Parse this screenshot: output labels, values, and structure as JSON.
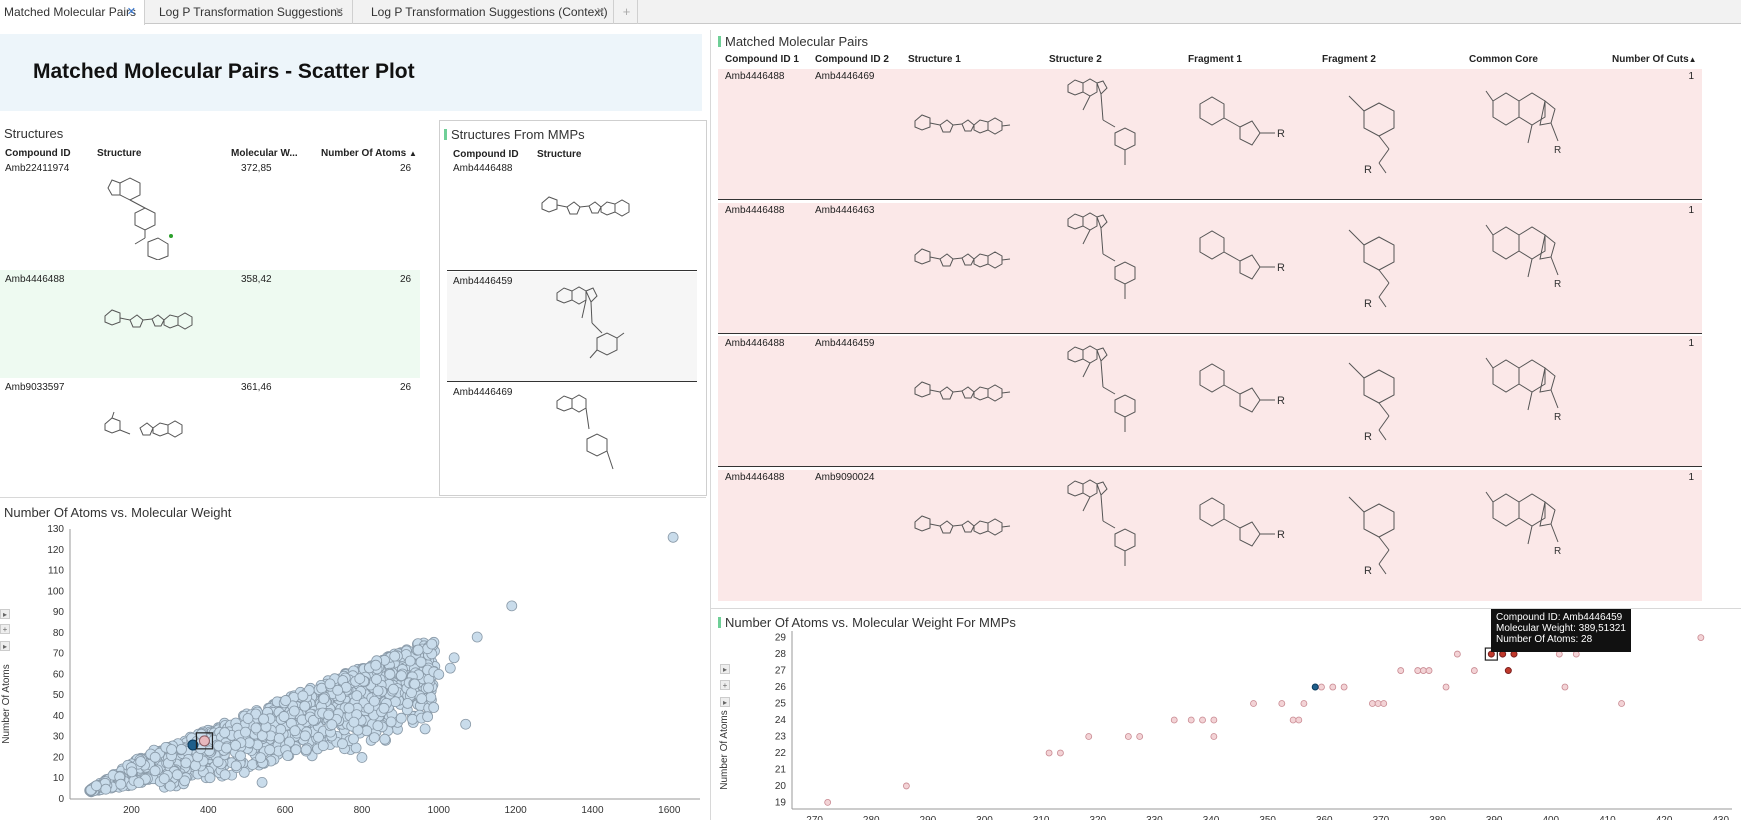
{
  "tabs": [
    {
      "label": "Matched Molecular Pairs"
    },
    {
      "label": "Log P Transformation Suggestions"
    },
    {
      "label": "Log P Transformation Suggestions (Context)"
    }
  ],
  "add_tab": "+",
  "banner": {
    "title": "Matched Molecular Pairs - Scatter Plot"
  },
  "structures": {
    "title": "Structures",
    "columns": [
      "Compound ID",
      "Structure",
      "Molecular W...",
      "Number Of Atoms"
    ],
    "sort_arrow": "▲",
    "rows": [
      {
        "id": "Amb22411974",
        "mw": "372,85",
        "atoms": "26"
      },
      {
        "id": "Amb4446488",
        "mw": "358,42",
        "atoms": "26"
      },
      {
        "id": "Amb9033597",
        "mw": "361,46",
        "atoms": "26"
      }
    ]
  },
  "structures_mmp": {
    "title": "Structures From MMPs",
    "columns": [
      "Compound ID",
      "Structure"
    ],
    "rows": [
      {
        "id": "Amb4446488"
      },
      {
        "id": "Amb4446459"
      },
      {
        "id": "Amb4446469"
      }
    ]
  },
  "mmp_table": {
    "title": "Matched Molecular Pairs",
    "columns": [
      "Compound ID 1",
      "Compound ID 2",
      "Structure 1",
      "Structure 2",
      "Fragment 1",
      "Fragment 2",
      "Common Core",
      "Number Of Cuts"
    ],
    "sort_arrow": "▲",
    "rows": [
      {
        "id1": "Amb4446488",
        "id2": "Amb4446469",
        "cuts": "1"
      },
      {
        "id1": "Amb4446488",
        "id2": "Amb4446463",
        "cuts": "1"
      },
      {
        "id1": "Amb4446488",
        "id2": "Amb4446459",
        "cuts": "1"
      },
      {
        "id1": "Amb4446488",
        "id2": "Amb9090024",
        "cuts": "1"
      }
    ],
    "row_bg": "#fbe8e8"
  },
  "plot1": {
    "title": "Number Of Atoms vs. Molecular Weight",
    "ylabel": "Number Of Atoms",
    "point_color": "#c9dceb",
    "highlight_color": "#1f5f8b"
  },
  "plot2": {
    "title": "Number Of Atoms vs. Molecular Weight For MMPs",
    "ylabel": "Number Of Atoms",
    "point_color": "#f3d3d6",
    "marked_color": "#c0392b",
    "tooltip": [
      "Compound ID: Amb4446459",
      "Molecular Weight: 389,51321",
      "Number Of Atoms: 28"
    ]
  },
  "side_buttons": [
    "▸",
    "+",
    "▸"
  ],
  "chart_data": [
    {
      "type": "scatter",
      "title": "Number Of Atoms vs. Molecular Weight",
      "xlabel": "",
      "ylabel": "Number Of Atoms",
      "xlim": [
        40,
        1680
      ],
      "ylim": [
        0,
        130
      ],
      "xticks": [
        200,
        400,
        600,
        800,
        1000,
        1200,
        1400,
        1600
      ],
      "yticks": [
        0,
        10,
        20,
        30,
        40,
        50,
        60,
        70,
        80,
        90,
        100,
        110,
        120,
        130
      ],
      "outliers": [
        [
          1610,
          126
        ],
        [
          1190,
          93
        ],
        [
          1070,
          36
        ],
        [
          1100,
          78
        ],
        [
          1040,
          68
        ],
        [
          1030,
          63
        ],
        [
          1000,
          60
        ],
        [
          800,
          20
        ],
        [
          540,
          8
        ]
      ],
      "highlight": [
        [
          360,
          26
        ]
      ],
      "marked": [
        [
          390,
          28
        ]
      ]
    },
    {
      "type": "scatter",
      "title": "Number Of Atoms vs. Molecular Weight For MMPs",
      "xlabel": "",
      "ylabel": "Number Of Atoms",
      "xlim": [
        266,
        432
      ],
      "ylim": [
        18.6,
        29.4
      ],
      "xticks": [
        270,
        280,
        290,
        300,
        310,
        320,
        330,
        340,
        350,
        360,
        370,
        380,
        390,
        400,
        410,
        420,
        430
      ],
      "yticks": [
        19,
        20,
        21,
        22,
        23,
        24,
        25,
        26,
        27,
        28,
        29
      ],
      "points": [
        [
          272.3,
          19
        ],
        [
          286.2,
          20
        ],
        [
          311.4,
          22
        ],
        [
          313.4,
          22
        ],
        [
          318.4,
          23
        ],
        [
          325.4,
          23
        ],
        [
          327.4,
          23
        ],
        [
          333.5,
          24
        ],
        [
          336.5,
          24
        ],
        [
          338.5,
          24
        ],
        [
          340.5,
          23
        ],
        [
          340.5,
          24
        ],
        [
          347.5,
          25
        ],
        [
          352.5,
          25
        ],
        [
          354.5,
          24
        ],
        [
          355.5,
          24
        ],
        [
          356.4,
          25
        ],
        [
          359.5,
          26
        ],
        [
          361.5,
          26
        ],
        [
          363.5,
          26
        ],
        [
          368.5,
          25
        ],
        [
          369.5,
          25
        ],
        [
          370.5,
          25
        ],
        [
          373.5,
          27
        ],
        [
          376.5,
          27
        ],
        [
          377.5,
          27
        ],
        [
          378.5,
          27
        ],
        [
          381.5,
          26
        ],
        [
          383.5,
          28
        ],
        [
          386.5,
          27
        ],
        [
          401.5,
          28
        ],
        [
          402.5,
          26
        ],
        [
          404.5,
          28
        ],
        [
          412.5,
          25
        ],
        [
          426.5,
          29
        ]
      ],
      "highlight": [
        [
          358.4,
          26
        ]
      ],
      "marked": [
        [
          389.5,
          28
        ],
        [
          391.5,
          28
        ],
        [
          392.5,
          27
        ],
        [
          393.5,
          28
        ]
      ]
    }
  ]
}
